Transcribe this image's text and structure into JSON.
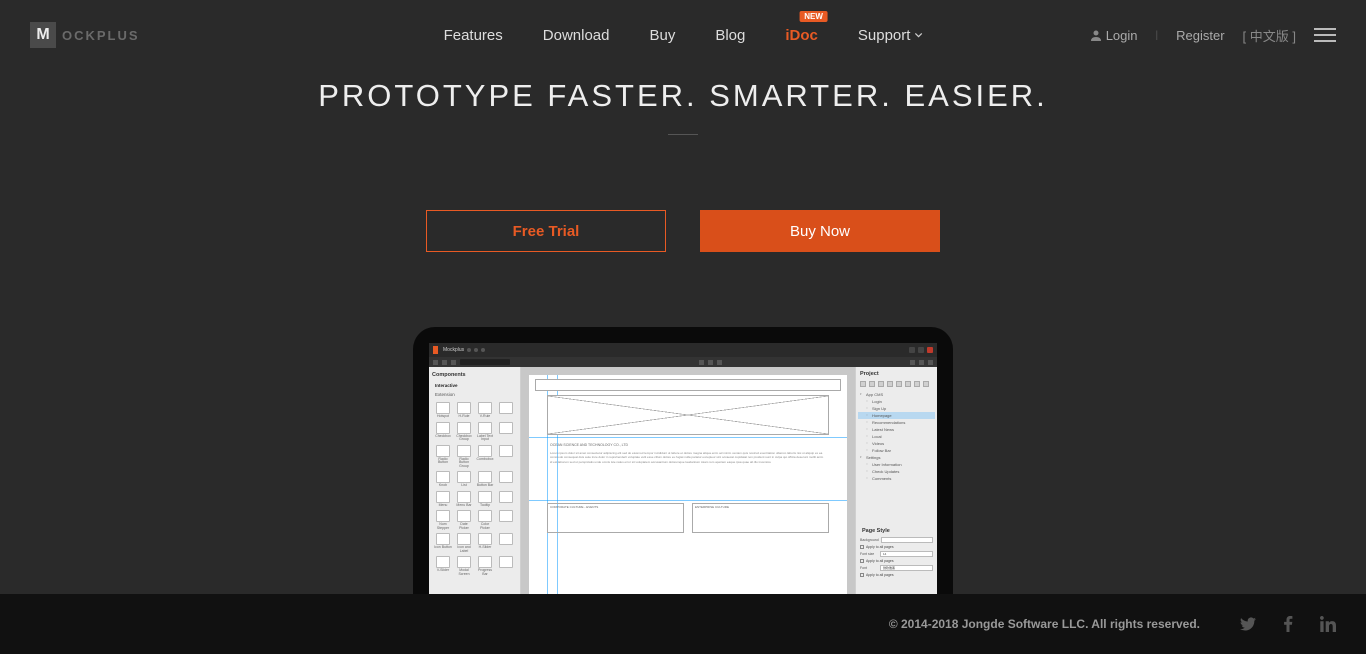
{
  "header": {
    "logo_text": "OCKPLUS",
    "nav": [
      {
        "label": "Features"
      },
      {
        "label": "Download"
      },
      {
        "label": "Buy"
      },
      {
        "label": "Blog"
      },
      {
        "label": "iDoc",
        "badge": "NEW",
        "active": true
      },
      {
        "label": "Support",
        "dropdown": true
      }
    ],
    "login": "Login",
    "register": "Register",
    "language": "[ 中文版 ]"
  },
  "hero": {
    "headline": "PROTOTYPE FASTER. SMARTER. EASIER.",
    "free_trial": "Free Trial",
    "buy_now": "Buy Now"
  },
  "app": {
    "title": "Mockplus",
    "left_panel": {
      "title": "Components",
      "sections": [
        "Interactive",
        "Extension"
      ],
      "components": [
        "Hotspot",
        "H-Rule",
        "V-Rule",
        "",
        "Checkbox",
        "Checkbox Group",
        "Label Text Input",
        "",
        "Radio Button",
        "Radio Button Group",
        "Combobox",
        "",
        "Knob",
        "List",
        "Button Bar",
        "",
        "Menu",
        "Menu Bar",
        "Tooltip",
        "",
        "Num Stepper",
        "Date Picker",
        "Color Picker",
        "",
        "Icon Button",
        "Icon and Label",
        "H-Slider",
        "",
        "V-Slider",
        "Modal Screen",
        "Progress Bar",
        ""
      ]
    },
    "right_panel": {
      "title": "Project",
      "tree": [
        {
          "label": "App CMS",
          "open": true
        },
        {
          "label": "Login",
          "sub": true
        },
        {
          "label": "Sign Up",
          "sub": true
        },
        {
          "label": "Homepage",
          "sub": true,
          "selected": true
        },
        {
          "label": "Recommendations",
          "sub": true
        },
        {
          "label": "Latest News",
          "sub": true
        },
        {
          "label": "Local",
          "sub": true
        },
        {
          "label": "Videos",
          "sub": true
        },
        {
          "label": "Follow Bar",
          "sub": true
        },
        {
          "label": "Settings",
          "open": true
        },
        {
          "label": "User Information",
          "sub": true
        },
        {
          "label": "Check Updates",
          "sub": true
        },
        {
          "label": "Comments",
          "sub": true
        }
      ],
      "style_title": "Page Style",
      "style": {
        "bg_label": "Background",
        "apply1": "Apply to all pages",
        "font_size_label": "Font size",
        "font_size_value": "14",
        "apply2": "Apply to all pages",
        "font_label": "Font",
        "font_value": "微软雅黑",
        "apply3": "Apply to all pages"
      }
    },
    "canvas": {
      "company": "OCEAN SCIENCE AND TECHNOLOGY CO., LTD",
      "card1": "CORPORATE CULTURE - EVENTS",
      "card2": "ENTERPRISE CULTURE"
    }
  },
  "footer": {
    "copyright": "© 2014-2018 Jongde Software LLC. All rights reserved."
  }
}
